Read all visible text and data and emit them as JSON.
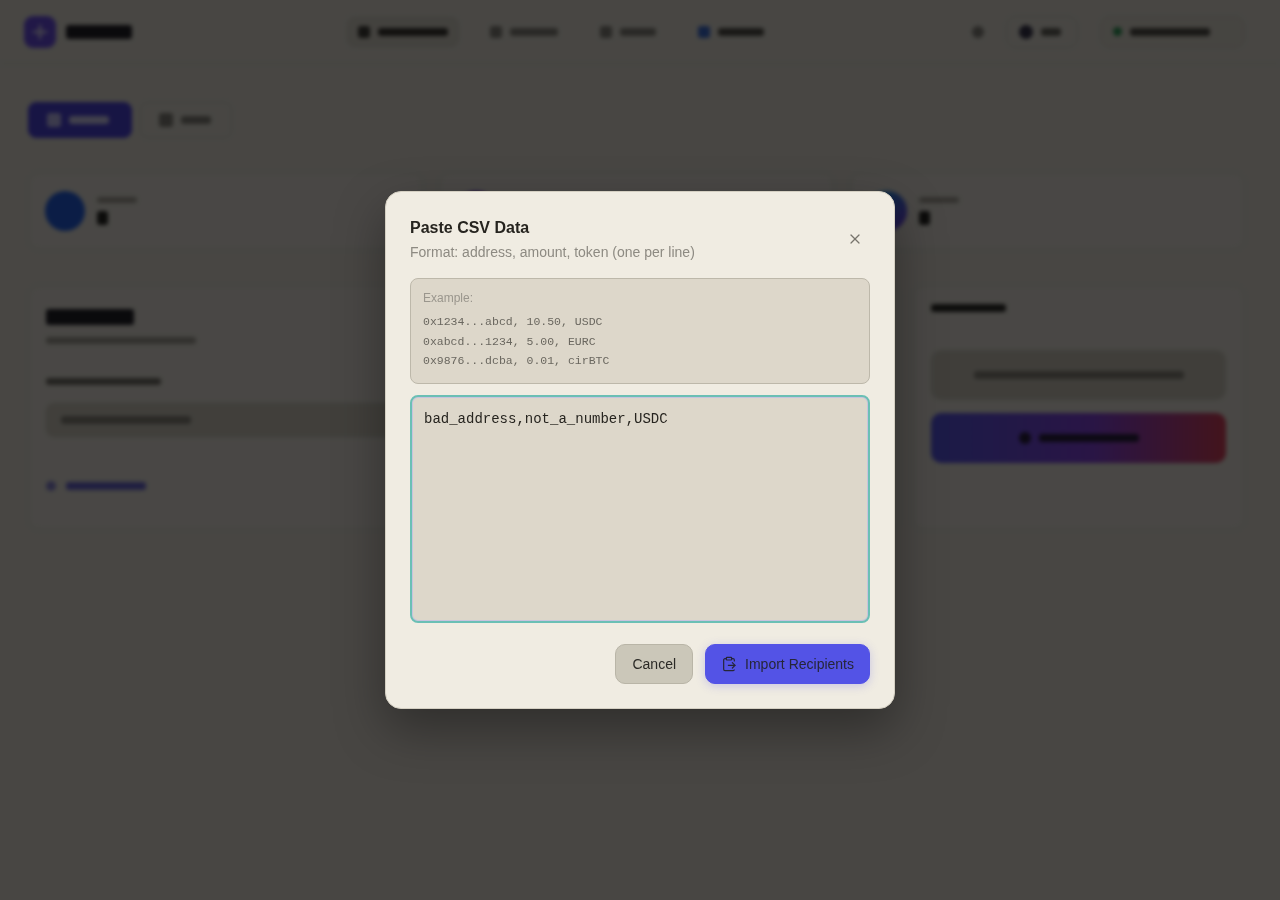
{
  "dialog": {
    "title": "Paste CSV Data",
    "subtitle": "Format: address, amount, token (one per line)",
    "example": {
      "label": "Example:",
      "lines": [
        "0x1234...abcd, 10.50, USDC",
        "0xabcd...1234, 5.00, EURC",
        "0x9876...dcba, 0.01, cirBTC"
      ]
    },
    "csv_input": {
      "value": "bad_address,not_a_number,USDC",
      "focused": true
    },
    "buttons": [
      {
        "label": "Cancel",
        "kind": "secondary"
      },
      {
        "label": "Import Recipients",
        "kind": "primary"
      }
    ]
  }
}
